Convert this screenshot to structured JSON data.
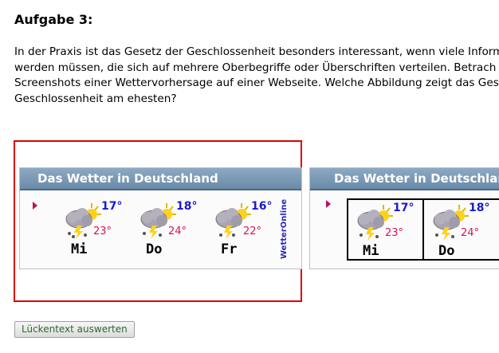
{
  "task": {
    "title": "Aufgabe 3:",
    "paragraph_lines": [
      "In der Praxis ist das Gesetz der Geschlossenheit besonders interessant, wenn viele Inform",
      "werden müssen, die sich auf mehrere Oberbegriffe oder Überschriften verteilen. Betrach",
      "Screenshots einer Wettervorhersage auf einer Webseite. Welche Abbildung zeigt das Ges",
      "Geschlossenheit am ehesten?"
    ]
  },
  "option_a": {
    "header": "Das Wetter in Deutschland",
    "logo": "WetterOnline",
    "days": [
      {
        "name": "Mi",
        "high": "17°",
        "low": "23°",
        "icon": "storm-cloud-sun-icon"
      },
      {
        "name": "Do",
        "high": "18°",
        "low": "24°",
        "icon": "storm-cloud-sun-icon"
      },
      {
        "name": "Fr",
        "high": "16°",
        "low": "22°",
        "icon": "storm-cloud-sun-icon"
      }
    ]
  },
  "option_b": {
    "header": "Das Wetter in Deutschlan",
    "days": [
      {
        "name": "Mi",
        "high": "17°",
        "low": "23°",
        "icon": "storm-cloud-sun-icon"
      },
      {
        "name": "Do",
        "high": "18°",
        "low": "24°",
        "icon": "storm-cloud-sun-icon"
      }
    ]
  },
  "colors": {
    "selection_border": "#e00000",
    "header_blue": "#7896b4",
    "high_temp": "#1a1acc",
    "low_temp": "#d4145a"
  },
  "submit_button": {
    "label": "Lückentext auswerten"
  }
}
